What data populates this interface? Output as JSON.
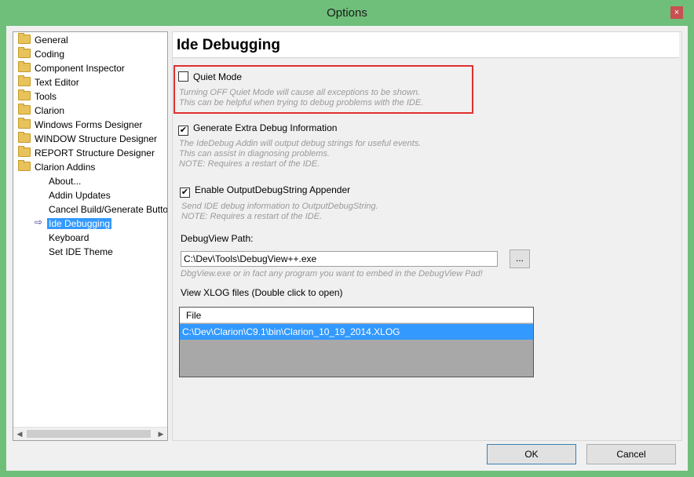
{
  "window": {
    "title": "Options",
    "close_icon": "×"
  },
  "tree": {
    "items": [
      {
        "label": "General",
        "type": "folder"
      },
      {
        "label": "Coding",
        "type": "folder"
      },
      {
        "label": "Component Inspector",
        "type": "folder"
      },
      {
        "label": "Text Editor",
        "type": "folder"
      },
      {
        "label": "Tools",
        "type": "folder"
      },
      {
        "label": "Clarion",
        "type": "folder"
      },
      {
        "label": "Windows Forms Designer",
        "type": "folder"
      },
      {
        "label": "WINDOW Structure Designer",
        "type": "folder"
      },
      {
        "label": "REPORT Structure Designer",
        "type": "folder"
      },
      {
        "label": "Clarion Addins",
        "type": "folder-open"
      },
      {
        "label": "About...",
        "type": "child"
      },
      {
        "label": "Addin Updates",
        "type": "child"
      },
      {
        "label": "Cancel Build/Generate Butto",
        "type": "child"
      },
      {
        "label": "Ide Debugging",
        "type": "child",
        "selected": true
      },
      {
        "label": "Keyboard",
        "type": "child"
      },
      {
        "label": "Set IDE Theme",
        "type": "child"
      }
    ],
    "selected_arrow": "⇨",
    "scroll_left": "◀",
    "scroll_right": "▶"
  },
  "panel": {
    "title": "Ide Debugging",
    "quiet_mode": {
      "label": "Quiet Mode",
      "checked": false,
      "description": "Turning OFF Quiet Mode will cause all exceptions to be shown.\nThis can be helpful when trying to debug problems with the IDE."
    },
    "extra_debug": {
      "label": "Generate Extra Debug Information",
      "checked": true,
      "check_mark": "✔",
      "description": "The IdeDebug Addin will output debug strings for useful events.\nThis can assist in diagnosing problems.\nNOTE: Requires a restart of the IDE."
    },
    "output_debug": {
      "label": "Enable OutputDebugString Appender",
      "checked": true,
      "check_mark": "✔",
      "description": "Send IDE debug information to OutputDebugString.\nNOTE: Requires a restart of the IDE."
    },
    "debugview": {
      "label": "DebugView Path:",
      "value": "C:\\Dev\\Tools\\DebugView++.exe",
      "browse_label": "...",
      "hint": "DbgView.exe or in fact any program you want to embed in the DebugView Pad!"
    },
    "xlog": {
      "label": "View XLOG files (Double click to open)",
      "column": "File",
      "rows": [
        "C:\\Dev\\Clarion\\C9.1\\bin\\Clarion_10_19_2014.XLOG"
      ]
    }
  },
  "buttons": {
    "ok": "OK",
    "cancel": "Cancel"
  },
  "colors": {
    "title_bar": "#6fbf7a",
    "selection": "#3399ff",
    "highlight_box": "#e03030"
  }
}
